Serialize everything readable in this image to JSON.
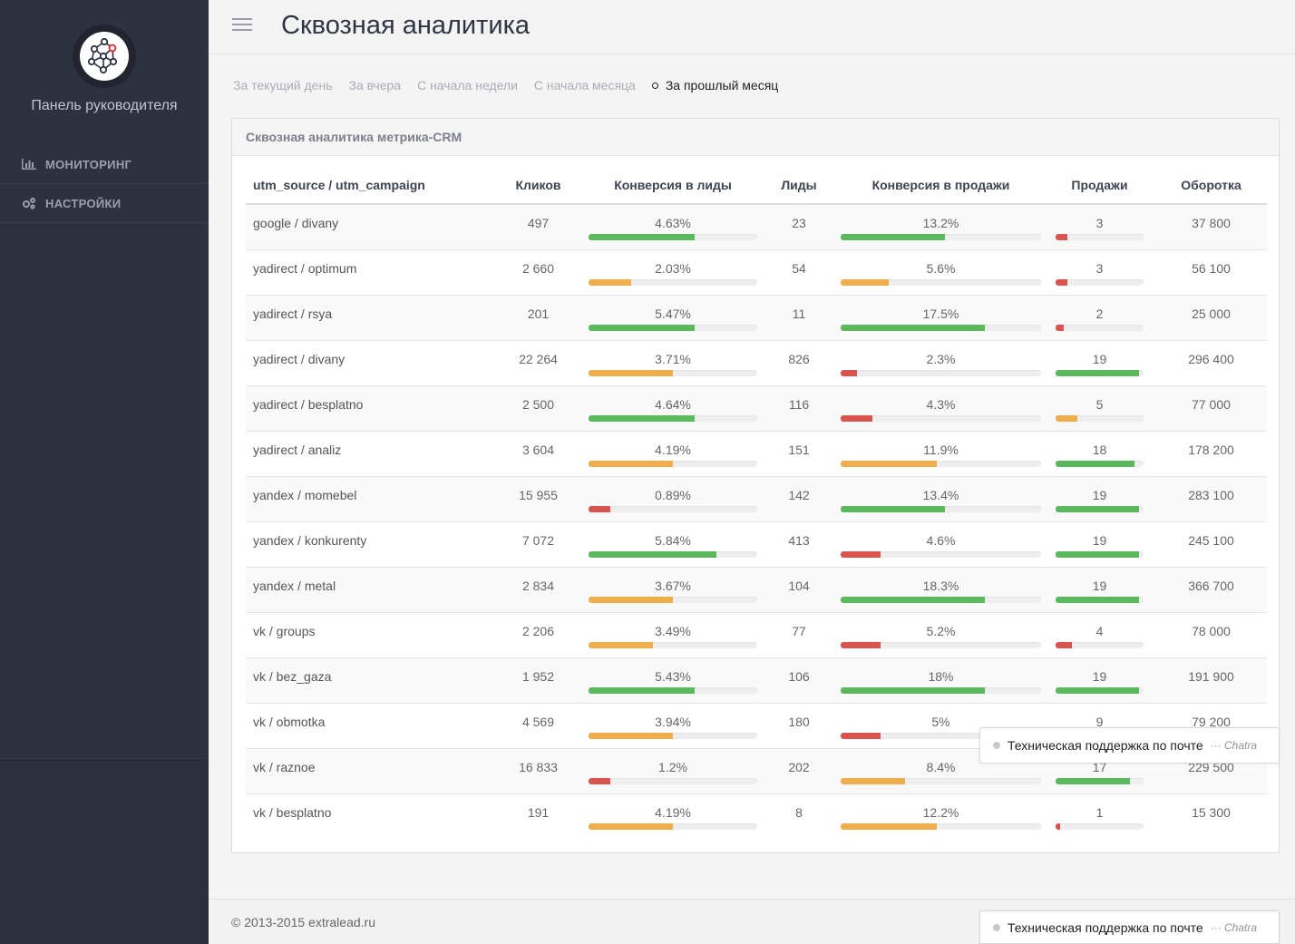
{
  "sidebar": {
    "title": "Панель руководителя",
    "items": [
      {
        "label": "МОНИТОРИНГ",
        "icon": "bar-chart-icon"
      },
      {
        "label": "НАСТРОЙКИ",
        "icon": "gears-icon"
      }
    ]
  },
  "header": {
    "title": "Сквозная аналитика"
  },
  "filters": [
    {
      "label": "За текущий день",
      "active": false
    },
    {
      "label": "За вчера",
      "active": false
    },
    {
      "label": "С начала недели",
      "active": false
    },
    {
      "label": "С начала месяца",
      "active": false
    },
    {
      "label": "За прошлый месяц",
      "active": true
    }
  ],
  "panel": {
    "title": "Сквозная аналитика метрика-CRM",
    "columns": [
      "utm_source / utm_campaign",
      "Кликов",
      "Конверсия в лиды",
      "Лиды",
      "Конверсия в продажи",
      "Продажи",
      "Оборотка"
    ],
    "rows": [
      {
        "source": "google / divany",
        "clicks": "497",
        "conv_leads": "4.63%",
        "leads": "23",
        "conv_sales": "13.2%",
        "sales": "3",
        "turnover": "37 800",
        "bar_leads": {
          "fill": 0.63,
          "color": "green"
        },
        "bar_sales": {
          "fill": 0.52,
          "color": "green"
        },
        "bar_prod": {
          "fill": 0.13,
          "color": "red"
        }
      },
      {
        "source": "yadirect / optimum",
        "clicks": "2 660",
        "conv_leads": "2.03%",
        "leads": "54",
        "conv_sales": "5.6%",
        "sales": "3",
        "turnover": "56 100",
        "bar_leads": {
          "fill": 0.25,
          "color": "orange"
        },
        "bar_sales": {
          "fill": 0.24,
          "color": "orange"
        },
        "bar_prod": {
          "fill": 0.13,
          "color": "red"
        }
      },
      {
        "source": "yadirect / rsya",
        "clicks": "201",
        "conv_leads": "5.47%",
        "leads": "11",
        "conv_sales": "17.5%",
        "sales": "2",
        "turnover": "25 000",
        "bar_leads": {
          "fill": 0.63,
          "color": "green"
        },
        "bar_sales": {
          "fill": 0.72,
          "color": "green"
        },
        "bar_prod": {
          "fill": 0.09,
          "color": "red"
        }
      },
      {
        "source": "yadirect / divany",
        "clicks": "22 264",
        "conv_leads": "3.71%",
        "leads": "826",
        "conv_sales": "2.3%",
        "sales": "19",
        "turnover": "296 400",
        "bar_leads": {
          "fill": 0.5,
          "color": "orange"
        },
        "bar_sales": {
          "fill": 0.08,
          "color": "red"
        },
        "bar_prod": {
          "fill": 0.95,
          "color": "green"
        }
      },
      {
        "source": "yadirect / besplatno",
        "clicks": "2 500",
        "conv_leads": "4.64%",
        "leads": "116",
        "conv_sales": "4.3%",
        "sales": "5",
        "turnover": "77 000",
        "bar_leads": {
          "fill": 0.63,
          "color": "green"
        },
        "bar_sales": {
          "fill": 0.16,
          "color": "red"
        },
        "bar_prod": {
          "fill": 0.25,
          "color": "orange"
        }
      },
      {
        "source": "yadirect / analiz",
        "clicks": "3 604",
        "conv_leads": "4.19%",
        "leads": "151",
        "conv_sales": "11.9%",
        "sales": "18",
        "turnover": "178 200",
        "bar_leads": {
          "fill": 0.5,
          "color": "orange"
        },
        "bar_sales": {
          "fill": 0.48,
          "color": "orange"
        },
        "bar_prod": {
          "fill": 0.9,
          "color": "green"
        }
      },
      {
        "source": "yandex / momebel",
        "clicks": "15 955",
        "conv_leads": "0.89%",
        "leads": "142",
        "conv_sales": "13.4%",
        "sales": "19",
        "turnover": "283 100",
        "bar_leads": {
          "fill": 0.13,
          "color": "red"
        },
        "bar_sales": {
          "fill": 0.52,
          "color": "green"
        },
        "bar_prod": {
          "fill": 0.95,
          "color": "green"
        }
      },
      {
        "source": "yandex / konkurenty",
        "clicks": "7 072",
        "conv_leads": "5.84%",
        "leads": "413",
        "conv_sales": "4.6%",
        "sales": "19",
        "turnover": "245 100",
        "bar_leads": {
          "fill": 0.76,
          "color": "green"
        },
        "bar_sales": {
          "fill": 0.2,
          "color": "red"
        },
        "bar_prod": {
          "fill": 0.95,
          "color": "green"
        }
      },
      {
        "source": "yandex / metal",
        "clicks": "2 834",
        "conv_leads": "3.67%",
        "leads": "104",
        "conv_sales": "18.3%",
        "sales": "19",
        "turnover": "366 700",
        "bar_leads": {
          "fill": 0.5,
          "color": "orange"
        },
        "bar_sales": {
          "fill": 0.72,
          "color": "green"
        },
        "bar_prod": {
          "fill": 0.95,
          "color": "green"
        }
      },
      {
        "source": "vk / groups",
        "clicks": "2 206",
        "conv_leads": "3.49%",
        "leads": "77",
        "conv_sales": "5.2%",
        "sales": "4",
        "turnover": "78 000",
        "bar_leads": {
          "fill": 0.38,
          "color": "orange"
        },
        "bar_sales": {
          "fill": 0.2,
          "color": "red"
        },
        "bar_prod": {
          "fill": 0.19,
          "color": "red"
        }
      },
      {
        "source": "vk / bez_gaza",
        "clicks": "1 952",
        "conv_leads": "5.43%",
        "leads": "106",
        "conv_sales": "18%",
        "sales": "19",
        "turnover": "191 900",
        "bar_leads": {
          "fill": 0.63,
          "color": "green"
        },
        "bar_sales": {
          "fill": 0.72,
          "color": "green"
        },
        "bar_prod": {
          "fill": 0.95,
          "color": "green"
        }
      },
      {
        "source": "vk / obmotka",
        "clicks": "4 569",
        "conv_leads": "3.94%",
        "leads": "180",
        "conv_sales": "5%",
        "sales": "9",
        "turnover": "79 200",
        "bar_leads": {
          "fill": 0.5,
          "color": "orange"
        },
        "bar_sales": {
          "fill": 0.2,
          "color": "red"
        },
        "bar_prod": {
          "fill": 0.45,
          "color": "orange"
        }
      },
      {
        "source": "vk / raznoe",
        "clicks": "16 833",
        "conv_leads": "1.2%",
        "leads": "202",
        "conv_sales": "8.4%",
        "sales": "17",
        "turnover": "229 500",
        "bar_leads": {
          "fill": 0.13,
          "color": "red"
        },
        "bar_sales": {
          "fill": 0.32,
          "color": "orange"
        },
        "bar_prod": {
          "fill": 0.85,
          "color": "green"
        }
      },
      {
        "source": "vk / besplatno",
        "clicks": "191",
        "conv_leads": "4.19%",
        "leads": "8",
        "conv_sales": "12.2%",
        "sales": "1",
        "turnover": "15 300",
        "bar_leads": {
          "fill": 0.5,
          "color": "orange"
        },
        "bar_sales": {
          "fill": 0.48,
          "color": "orange"
        },
        "bar_prod": {
          "fill": 0.05,
          "color": "red"
        }
      }
    ]
  },
  "footer": {
    "copyright": "© 2013-2015 extralead.ru"
  },
  "chat": {
    "label": "Техническая поддержка по почте",
    "brand": "··· Chatra"
  },
  "colors": {
    "green": "#5cb85c",
    "orange": "#f0ad4e",
    "red": "#d9534f",
    "sidebar": "#2d3140"
  }
}
